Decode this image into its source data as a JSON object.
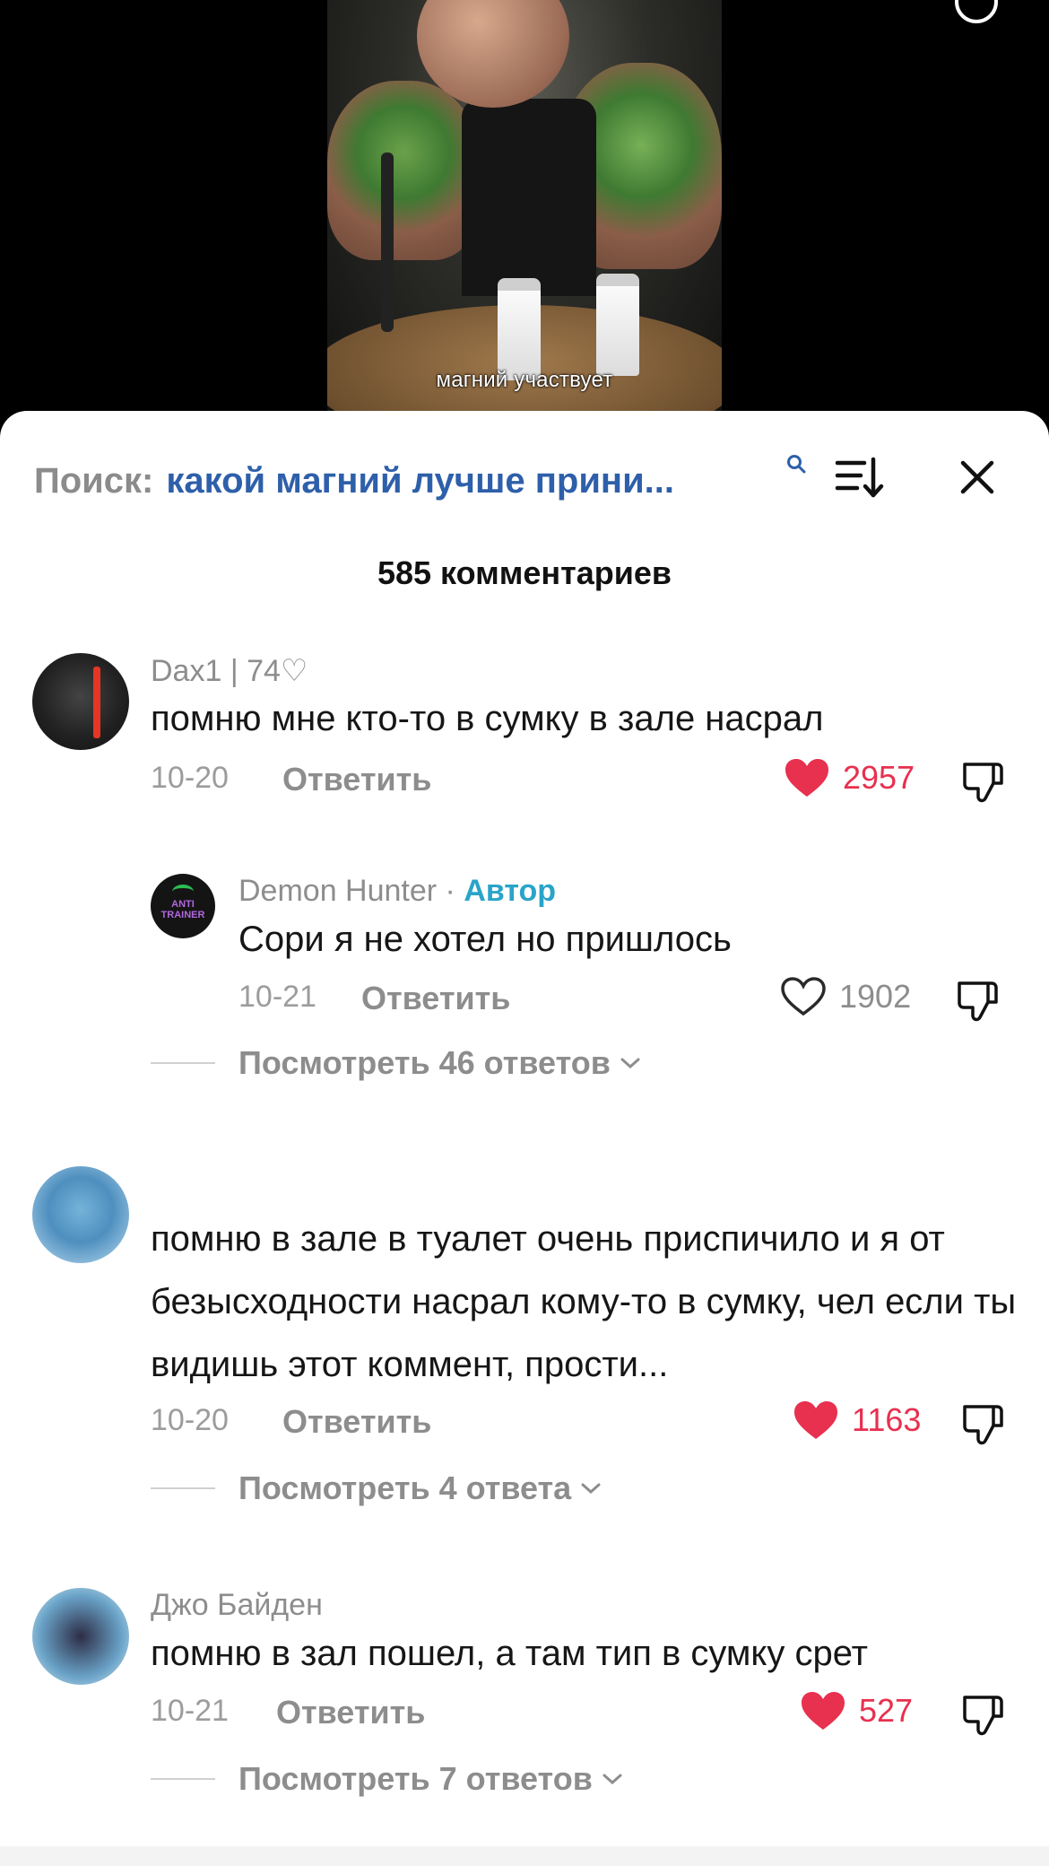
{
  "video": {
    "caption": "магний участвует"
  },
  "search": {
    "prefix": "Поиск:",
    "query": "какой магний лучше прини..."
  },
  "comments_count": "585 комментариев",
  "comments": [
    {
      "username": "Dax1 | 74♡",
      "text": "помню мне кто-то в сумку в зале насрал",
      "date": "10-20",
      "reply_label": "Ответить",
      "likes": "2957",
      "liked": true
    },
    {
      "username": "",
      "text": "помню в зале в туалет очень приспичило и я от безысходности насрал кому-то в сумку, чел если ты видишь этот коммент, прости...",
      "date": "10-20",
      "reply_label": "Ответить",
      "likes": "1163",
      "liked": true,
      "view_more": "Посмотреть 4 ответа"
    },
    {
      "username": "Джо Байден",
      "text": "помню в зал пошел, а там тип в сумку срет",
      "date": "10-21",
      "reply_label": "Ответить",
      "likes": "527",
      "liked": true,
      "view_more": "Посмотреть 7 ответов"
    }
  ],
  "reply": {
    "username": "Demon Hunter",
    "separator": " · ",
    "author_badge": "Автор",
    "avatar_text": "ANTI TRAINER",
    "text": "Сори я не хотел но пришлось",
    "date": "10-21",
    "reply_label": "Ответить",
    "likes": "1902",
    "liked": false,
    "view_more": "Посмотреть 46 ответов"
  },
  "colors": {
    "like_red": "#e8304f",
    "author_blue": "#2aa4c9",
    "search_query_blue": "#2e5faa",
    "muted_gray": "#8d8d8d"
  }
}
